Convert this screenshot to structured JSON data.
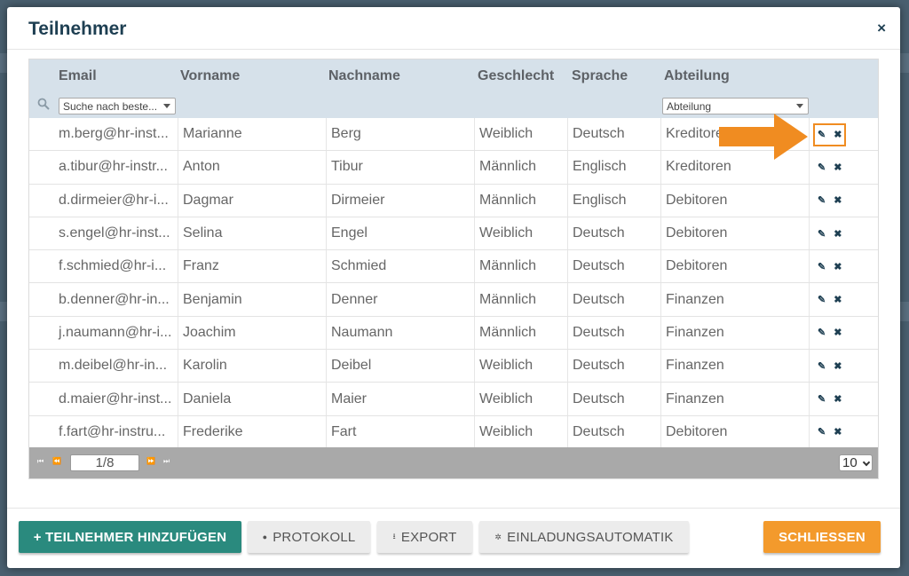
{
  "modal": {
    "title": "Teilnehmer",
    "close_glyph": "×"
  },
  "table": {
    "columns": [
      "Email",
      "Vorname",
      "Nachname",
      "Geschlecht",
      "Sprache",
      "Abteilung"
    ],
    "filters": {
      "email_placeholder": "Suche nach beste...",
      "abteilung_placeholder": "Abteilung"
    },
    "rows": [
      {
        "email": "m.berg@hr-inst...",
        "vorname": "Marianne",
        "nachname": "Berg",
        "geschlecht": "Weiblich",
        "sprache": "Deutsch",
        "abteilung": "Kreditoren"
      },
      {
        "email": "a.tibur@hr-instr...",
        "vorname": "Anton",
        "nachname": "Tibur",
        "geschlecht": "Männlich",
        "sprache": "Englisch",
        "abteilung": "Kreditoren"
      },
      {
        "email": "d.dirmeier@hr-i...",
        "vorname": "Dagmar",
        "nachname": "Dirmeier",
        "geschlecht": "Männlich",
        "sprache": "Englisch",
        "abteilung": "Debitoren"
      },
      {
        "email": "s.engel@hr-inst...",
        "vorname": "Selina",
        "nachname": "Engel",
        "geschlecht": "Weiblich",
        "sprache": "Deutsch",
        "abteilung": "Debitoren"
      },
      {
        "email": "f.schmied@hr-i...",
        "vorname": "Franz",
        "nachname": "Schmied",
        "geschlecht": "Männlich",
        "sprache": "Deutsch",
        "abteilung": "Debitoren"
      },
      {
        "email": "b.denner@hr-in...",
        "vorname": "Benjamin",
        "nachname": "Denner",
        "geschlecht": "Männlich",
        "sprache": "Deutsch",
        "abteilung": "Finanzen"
      },
      {
        "email": "j.naumann@hr-i...",
        "vorname": "Joachim",
        "nachname": "Naumann",
        "geschlecht": "Männlich",
        "sprache": "Deutsch",
        "abteilung": "Finanzen"
      },
      {
        "email": "m.deibel@hr-in...",
        "vorname": "Karolin",
        "nachname": "Deibel",
        "geschlecht": "Weiblich",
        "sprache": "Deutsch",
        "abteilung": "Finanzen"
      },
      {
        "email": "d.maier@hr-inst...",
        "vorname": "Daniela",
        "nachname": "Maier",
        "geschlecht": "Weiblich",
        "sprache": "Deutsch",
        "abteilung": "Finanzen"
      },
      {
        "email": "f.fart@hr-instru...",
        "vorname": "Frederike",
        "nachname": "Fart",
        "geschlecht": "Weiblich",
        "sprache": "Deutsch",
        "abteilung": "Debitoren"
      }
    ]
  },
  "pager": {
    "page": "1/8",
    "page_size": "10"
  },
  "footer": {
    "add_label": "+ TEILNEHMER HINZUFÜGEN",
    "protokoll_label": "PROTOKOLL",
    "export_label": "EXPORT",
    "einladung_label": "EINLADUNGSAUTOMATIK",
    "close_label": "SCHLIESSEN"
  },
  "colors": {
    "accent_teal": "#2a8a7e",
    "accent_orange": "#f39a2c",
    "title_navy": "#1e3f52"
  },
  "icons": {
    "row_edit": "pencil-icon",
    "row_delete": "close-icon",
    "filter_search": "search-icon",
    "annotation": "arrow-right-icon"
  }
}
